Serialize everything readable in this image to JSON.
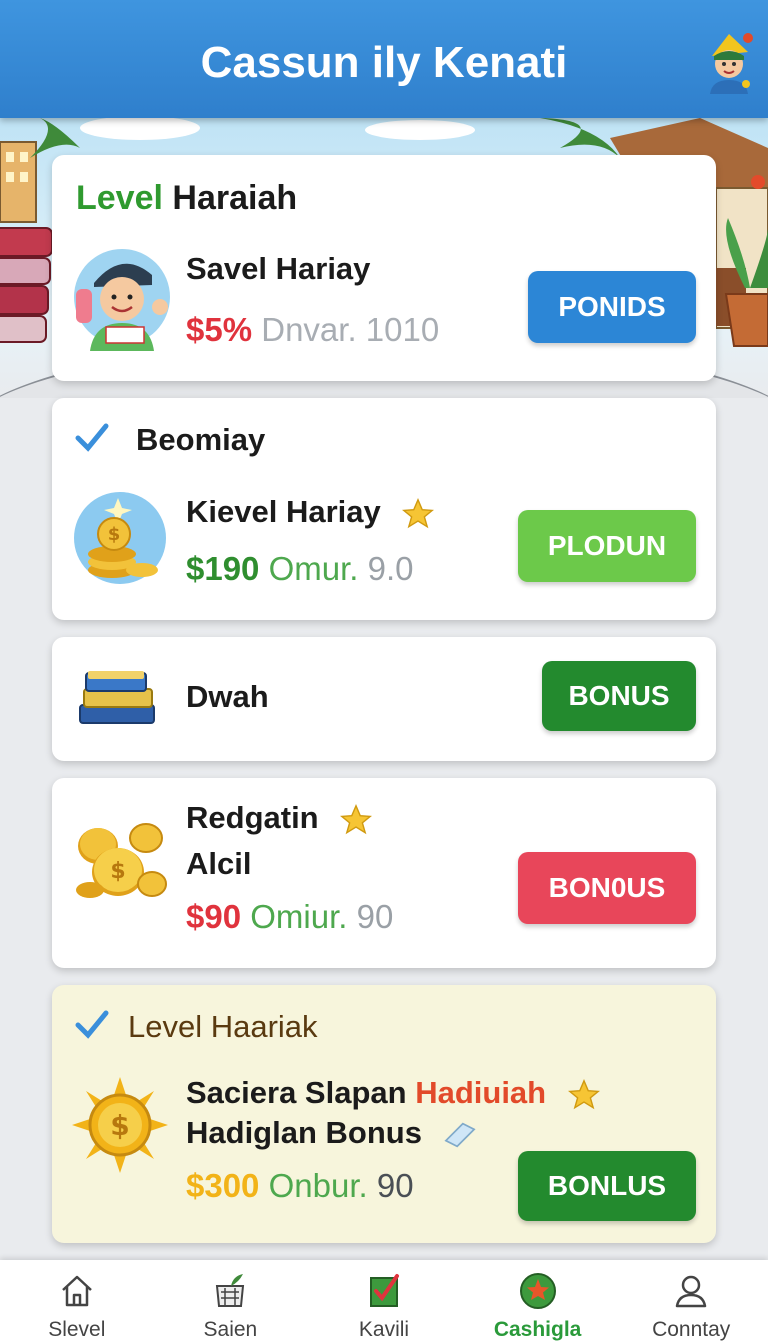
{
  "header": {
    "title": "Cassun ily Kenati"
  },
  "card1": {
    "title_highlight": "Level",
    "title_rest": "Haraiah",
    "item_title": "Savel Hariay",
    "price": "$5%",
    "desc": "Dnvar. 1010",
    "button": "PONIDS"
  },
  "card2": {
    "section": "Beomiay",
    "item_title": "Kievel Hariay",
    "price": "$190",
    "desc_a": "Omur.",
    "desc_b": "9.0",
    "button": "PLODUN"
  },
  "card3": {
    "item_title": "Dwah",
    "button": "BONUS"
  },
  "card4": {
    "item_title_1": "Redgatin",
    "item_title_2": "Alcil",
    "price": "$90",
    "desc_a": "Omiur.",
    "desc_b": "90",
    "button": "BON0US"
  },
  "card5": {
    "section": "Level Haariak",
    "item_title_1a": "Saciera Slapan",
    "item_title_1b": "Hadiuiah",
    "item_title_2": "Hadiglan Bonus",
    "price": "$300",
    "desc_a": "Onbur.",
    "desc_b": "90",
    "button": "BONLUS"
  },
  "nav": {
    "items": [
      {
        "label": "Slevel",
        "icon": "home-icon"
      },
      {
        "label": "Saien",
        "icon": "store-icon"
      },
      {
        "label": "Kavili",
        "icon": "checklist-icon"
      },
      {
        "label": "Cashigla",
        "icon": "star-badge-icon"
      },
      {
        "label": "Conntay",
        "icon": "profile-icon"
      }
    ]
  },
  "colors": {
    "header": "#2f86d6",
    "accent_green": "#2a9a3a",
    "button_blue": "#2c86d6",
    "button_lime": "#6cc94a",
    "button_darkgreen": "#238a2e",
    "button_pink": "#e8465a"
  }
}
